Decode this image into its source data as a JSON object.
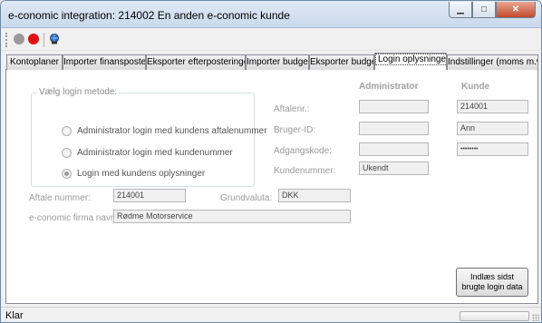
{
  "window": {
    "title": "e-conomic integration: 214002 En anden e-conomic kunde"
  },
  "titlebar": {
    "minimize": "▁",
    "maximize": "□",
    "close": "✕"
  },
  "toolbar": {
    "icons": [
      {
        "name": "grey-circle-icon",
        "color": "#9a9a9a"
      },
      {
        "name": "red-circle-icon",
        "color": "#e01010"
      },
      {
        "name": "globe-user-icon",
        "color": "#1f4f9a"
      }
    ]
  },
  "tabs": [
    {
      "label": "Kontoplaner"
    },
    {
      "label": "Importer finansposter"
    },
    {
      "label": "Eksporter efterposteringer"
    },
    {
      "label": "Importer budget"
    },
    {
      "label": "Eksporter budget"
    },
    {
      "label": "Login oplysninger"
    },
    {
      "label": "Indstillinger (moms m.v.)"
    }
  ],
  "login_group": {
    "legend": "Vælg login metode:",
    "options": [
      {
        "label": "Administrator login med kundens aftalenummer",
        "checked": false
      },
      {
        "label": "Administrator login med kundenummer",
        "checked": false
      },
      {
        "label": "Login med kundens oplysninger",
        "checked": true
      }
    ]
  },
  "credentials": {
    "admin_header": "Administrator",
    "customer_header": "Kunde",
    "rows": [
      {
        "label": "Aftalenr.:",
        "admin_value": "",
        "customer_value": "214001"
      },
      {
        "label": "Bruger-ID:",
        "admin_value": "",
        "customer_value": "Ann"
      },
      {
        "label": "Adgangskode:",
        "admin_value": "",
        "customer_value": "••••••••"
      }
    ],
    "customer_number_label": "Kundenummer:",
    "customer_number_value": "Ukendt"
  },
  "agreement": {
    "number_label": "Aftale nummer:",
    "number_value": "214001",
    "currency_label": "Grundvaluta:",
    "currency_value": "DKK",
    "company_label": "e-conomic firma navn:",
    "company_value": "Rødme Motorservice"
  },
  "load_button": {
    "line1": "Indlæs sidst",
    "line2": "brugte login data"
  },
  "status": {
    "text": "Klar"
  }
}
